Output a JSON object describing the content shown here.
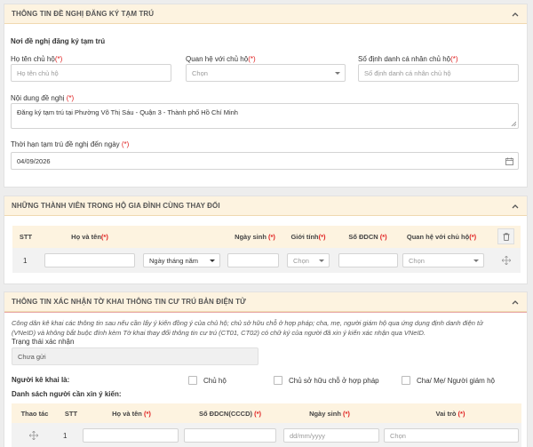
{
  "section1": {
    "title": "THÔNG TIN ĐỀ NGHỊ ĐĂNG KÝ TẠM TRÚ",
    "place_title": "Nơi đề nghị đăng ký tạm trú",
    "host_name_label": "Họ tên chủ hộ",
    "host_name_placeholder": "Họ tên chủ hộ",
    "relation_label": "Quan hệ với chủ hộ",
    "relation_placeholder": "Chọn",
    "host_id_label": "Số định danh cá nhân chủ hộ",
    "host_id_placeholder": "Số định danh cá nhân chủ hộ",
    "content_label": "Nội dung đề nghị",
    "content_value": "Đăng ký tạm trú tại Phường Võ Thị Sáu - Quận 3 - Thành phố Hồ Chí Minh",
    "deadline_label": "Thời hạn tạm trú đề nghị đến ngày",
    "deadline_value": "04/09/2026",
    "required_mark": "(*)"
  },
  "section2": {
    "title": "NHỮNG THÀNH VIÊN TRONG HỘ GIA ĐÌNH CÙNG THAY ĐỔI",
    "headers": {
      "stt": "STT",
      "name": "Họ và tên",
      "dob": "Ngày sinh",
      "gender": "Giới tính",
      "id": "Số ĐDCN",
      "relation": "Quan hệ với chủ hộ"
    },
    "row": {
      "stt": "1",
      "date_type": "Ngày tháng năm",
      "gender_placeholder": "Chọn",
      "relation_placeholder": "Chọn"
    }
  },
  "section3": {
    "title": "THÔNG TIN XÁC NHẬN TỜ KHAI THÔNG TIN CƯ TRÚ BẢN ĐIỆN TỬ",
    "note_line1": "Công dân kê khai các thông tin sau nếu cần lấy ý kiến đồng ý của chủ hộ; chủ sở hữu chỗ ở hợp pháp; cha, mẹ, người giám hộ qua ứng dụng định danh điện tử",
    "note_line2": "(VNeID) và không bắt buộc đính kèm Tờ khai thay đổi thông tin cư trú (CT01, CT02) có chữ ký của người đã xin ý kiến xác nhận qua VNeID.",
    "status_label": "Trạng thái xác nhận",
    "status_value": "Chưa gửi",
    "declarant_label": "Người kê khai là:",
    "opt_host": "Chủ hộ",
    "opt_owner": "Chủ sở hữu chỗ ở hợp pháp",
    "opt_parent": "Cha/ Mẹ/ Người giám hộ",
    "list_label": "Danh sách người cần xin ý kiến:",
    "headers": {
      "action": "Thao tác",
      "stt": "STT",
      "name": "Họ và tên",
      "id": "Số ĐDCN(CCCD)",
      "dob": "Ngày sinh",
      "role": "Vai trò"
    },
    "row": {
      "stt": "1",
      "dob_placeholder": "dd/mm/yyyy",
      "role_placeholder": "Chọn"
    }
  },
  "colors": {
    "header_bg": "#fdf3e0",
    "required": "#e02020"
  }
}
